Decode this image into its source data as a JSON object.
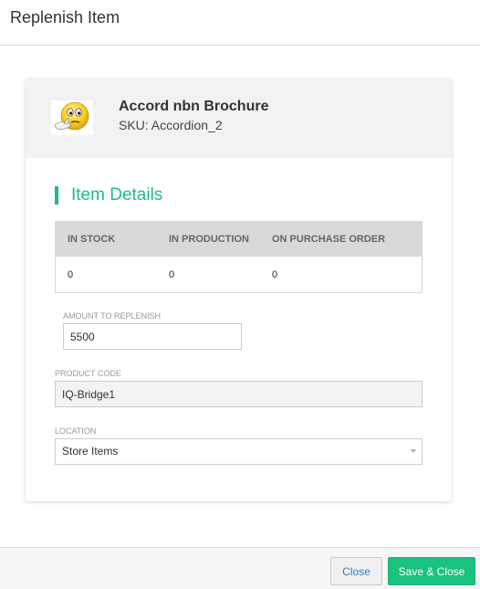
{
  "dialog": {
    "title": "Replenish Item"
  },
  "item": {
    "name": "Accord nbn Brochure",
    "sku": "SKU: Accordion_2",
    "thumbnail_icon": "thinking-emoji-icon"
  },
  "details": {
    "section_title": "Item Details",
    "stock_table": {
      "headers": [
        "IN STOCK",
        "IN PRODUCTION",
        "ON PURCHASE ORDER"
      ],
      "values": [
        "0",
        "0",
        "0"
      ]
    }
  },
  "form": {
    "amount_label": "AMOUNT TO REPLENISH",
    "amount_value": "5500",
    "product_code_label": "PRODUCT CODE",
    "product_code_value": "IQ-Bridge1",
    "location_label": "LOCATION",
    "location_value": "Store Items"
  },
  "footer": {
    "close_label": "Close",
    "save_close_label": "Save & Close"
  },
  "colors": {
    "accent": "#1dbd82",
    "save_button": "#19c27e",
    "close_text": "#337ab7"
  }
}
